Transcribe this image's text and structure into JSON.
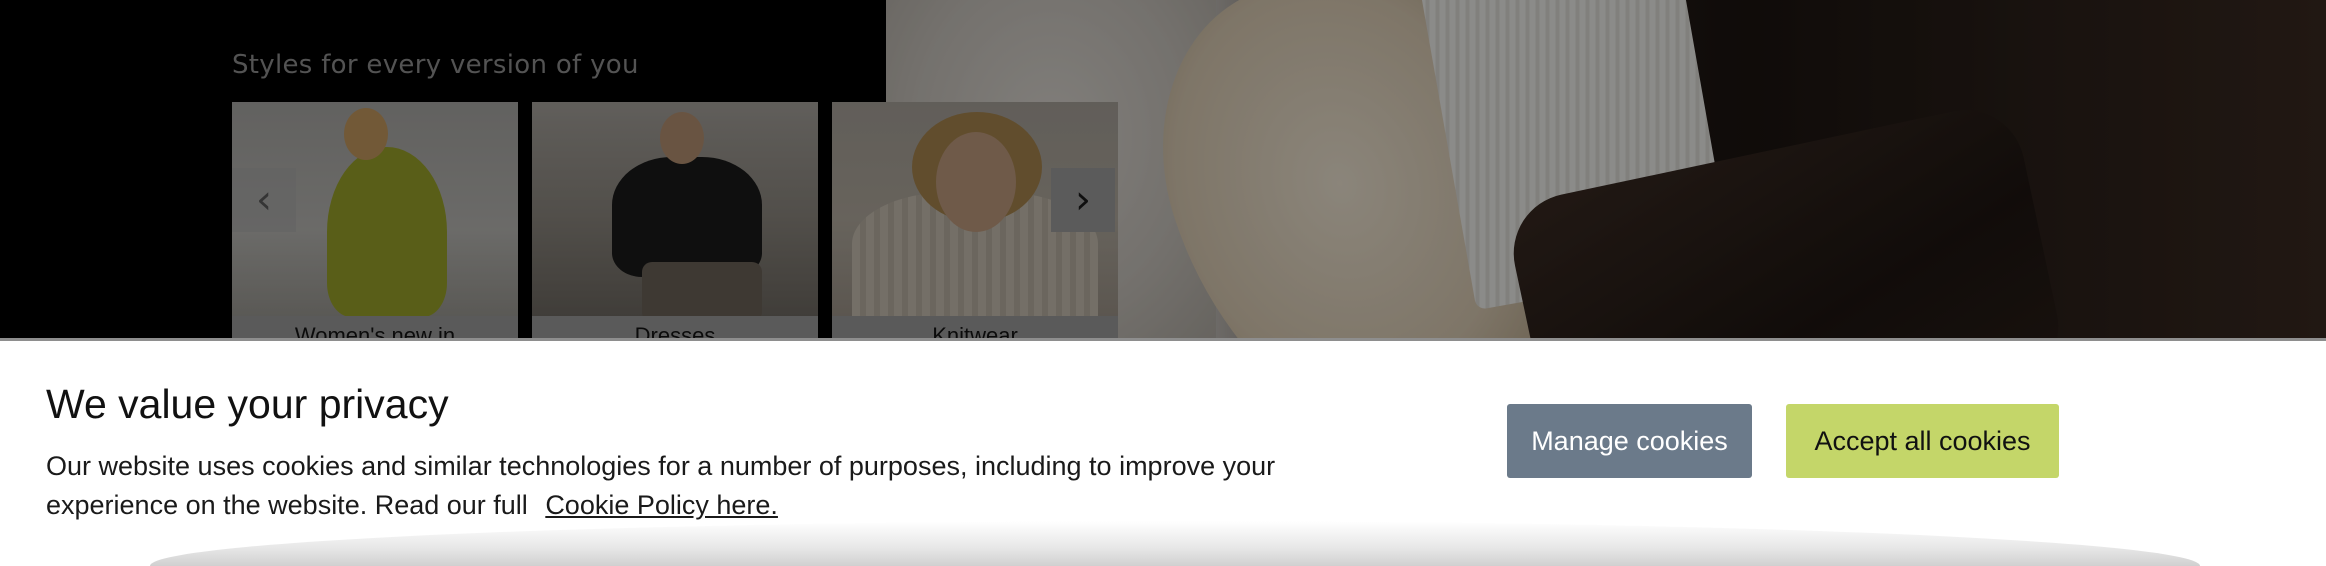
{
  "hero": {
    "section_title": "Styles for every version of you",
    "carousel": {
      "prev_icon": "chevron-left-icon",
      "next_icon": "chevron-right-icon",
      "prev_glyph": "‹",
      "next_glyph": "›",
      "cards": [
        {
          "label": "Women's new in"
        },
        {
          "label": "Dresses"
        },
        {
          "label": "Knitwear"
        }
      ]
    }
  },
  "cookie_banner": {
    "title": "We value your privacy",
    "body": "Our website uses cookies and similar technologies for a number of purposes, including to improve your experience on the website. Read our full",
    "policy_link": "Cookie Policy here.",
    "manage_button": "Manage cookies",
    "accept_button": "Accept all cookies",
    "colors": {
      "manage_bg": "#6b7a8a",
      "accept_bg": "#c4d669"
    }
  }
}
